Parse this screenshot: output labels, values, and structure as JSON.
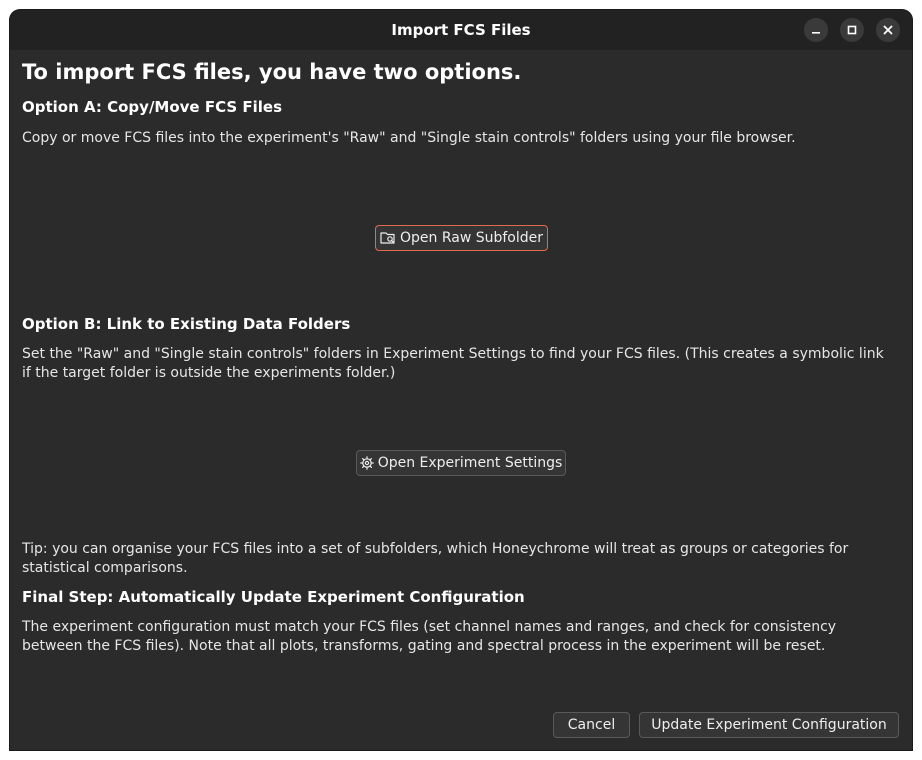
{
  "window": {
    "title": "Import FCS Files"
  },
  "main": {
    "heading": "To import FCS files, you have two options.",
    "option_a": {
      "title": "Option A: Copy/Move FCS Files",
      "description": "Copy or move FCS files into the experiment's \"Raw\" and \"Single stain controls\" folders using your file browser.",
      "button_label": "Open Raw Subfolder",
      "button_icon": "folder-search-icon"
    },
    "option_b": {
      "title": "Option B: Link to Existing Data Folders",
      "description": "Set the \"Raw\" and \"Single stain controls\" folders in Experiment Settings to find your FCS files. (This creates a symbolic link if the target folder is outside the experiments folder.)",
      "button_label": "Open Experiment Settings",
      "button_icon": "gear-icon"
    },
    "tip": "Tip: you can organise your FCS files into a set of subfolders, which Honeychrome will treat as groups or categories for statistical comparisons.",
    "final_step": {
      "title": "Final Step: Automatically Update Experiment Configuration",
      "description": "The experiment configuration must match your FCS files (set channel names and ranges, and check for consistency between the FCS files). Note that all plots, transforms, gating and spectral process in the experiment will be reset."
    }
  },
  "footer": {
    "cancel_label": "Cancel",
    "update_label": "Update Experiment Configuration"
  },
  "colors": {
    "background": "#2b2b2b",
    "titlebar": "#222222",
    "focus_accent": "#e06a4e"
  }
}
